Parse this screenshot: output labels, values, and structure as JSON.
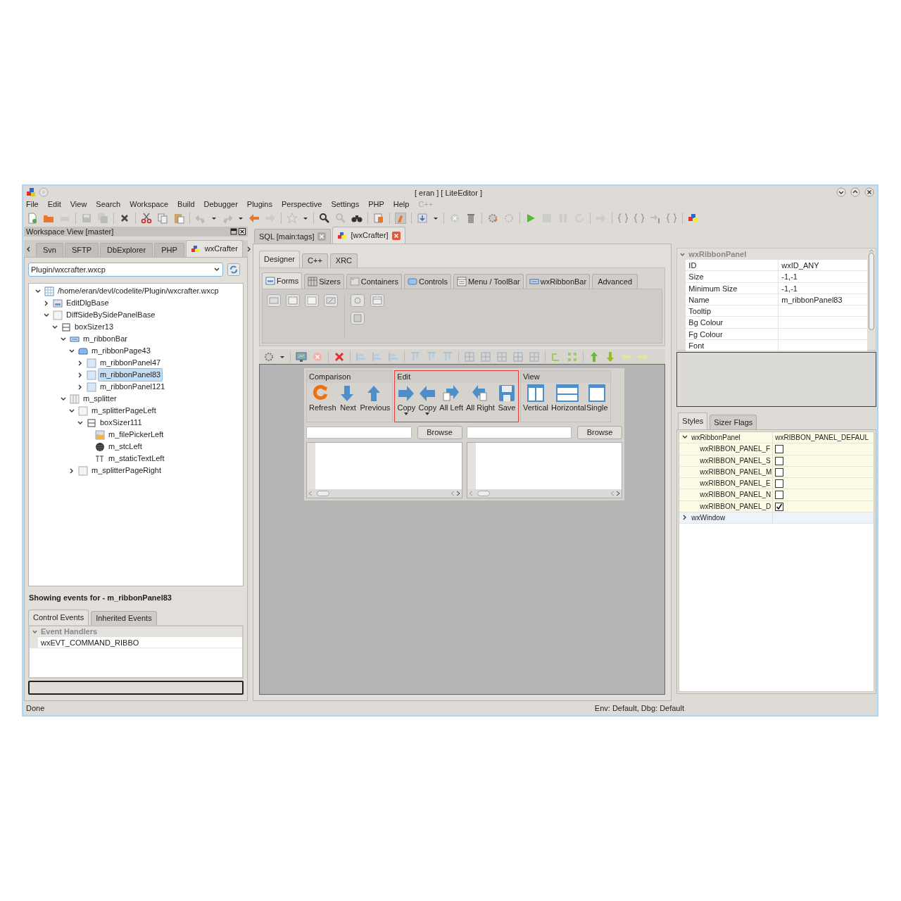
{
  "window": {
    "title": "[ eran ] [ LiteEditor ]"
  },
  "menu": [
    {
      "label": "File",
      "disabled": false
    },
    {
      "label": "Edit",
      "disabled": false
    },
    {
      "label": "View",
      "disabled": false
    },
    {
      "label": "Search",
      "disabled": false
    },
    {
      "label": "Workspace",
      "disabled": false
    },
    {
      "label": "Build",
      "disabled": false
    },
    {
      "label": "Debugger",
      "disabled": false
    },
    {
      "label": "Plugins",
      "disabled": false
    },
    {
      "label": "Perspective",
      "disabled": false
    },
    {
      "label": "Settings",
      "disabled": false
    },
    {
      "label": "PHP",
      "disabled": false
    },
    {
      "label": "Help",
      "disabled": false
    },
    {
      "label": "C++",
      "disabled": true
    }
  ],
  "workspace_view": {
    "title": "Workspace View [master]",
    "tabs": [
      {
        "label": "Svn",
        "selected": false
      },
      {
        "label": "SFTP",
        "selected": false
      },
      {
        "label": "DbExplorer",
        "selected": false
      },
      {
        "label": "PHP",
        "selected": false
      },
      {
        "label": "wxCrafter",
        "selected": true
      }
    ],
    "project": "Plugin/wxcrafter.wxcp",
    "tree": [
      {
        "label": "/home/eran/devl/codelite/Plugin/wxcrafter.wxcp",
        "kind": "project",
        "expanded": true,
        "selected": false,
        "children": [
          {
            "label": "EditDlgBase",
            "kind": "dialog",
            "expanded": false,
            "selected": false
          },
          {
            "label": "DiffSideBySidePanelBase",
            "kind": "panel",
            "expanded": true,
            "selected": false,
            "children": [
              {
                "label": "boxSizer13",
                "kind": "sizer",
                "expanded": true,
                "selected": false,
                "children": [
                  {
                    "label": "m_ribbonBar",
                    "kind": "ribbonbar",
                    "expanded": true,
                    "selected": false,
                    "children": [
                      {
                        "label": "m_ribbonPage43",
                        "kind": "ribbonpage",
                        "expanded": true,
                        "selected": false,
                        "children": [
                          {
                            "label": "m_ribbonPanel47",
                            "kind": "ribbonpanel",
                            "expanded": false,
                            "selected": false
                          },
                          {
                            "label": "m_ribbonPanel83",
                            "kind": "ribbonpanel",
                            "expanded": false,
                            "selected": true
                          },
                          {
                            "label": "m_ribbonPanel121",
                            "kind": "ribbonpanel",
                            "expanded": false,
                            "selected": false
                          }
                        ]
                      }
                    ]
                  },
                  {
                    "label": "m_splitter",
                    "kind": "splitter",
                    "expanded": true,
                    "selected": false,
                    "children": [
                      {
                        "label": "m_splitterPageLeft",
                        "kind": "panel",
                        "expanded": true,
                        "selected": false,
                        "children": [
                          {
                            "label": "boxSizer111",
                            "kind": "sizer",
                            "expanded": true,
                            "selected": false,
                            "children": [
                              {
                                "label": "m_filePickerLeft",
                                "kind": "filepicker",
                                "selected": false
                              },
                              {
                                "label": "m_stcLeft",
                                "kind": "stc",
                                "selected": false
                              },
                              {
                                "label": "m_staticTextLeft",
                                "kind": "statictext",
                                "selected": false
                              }
                            ]
                          }
                        ]
                      },
                      {
                        "label": "m_splitterPageRight",
                        "kind": "panel",
                        "expanded": false,
                        "selected": false
                      }
                    ]
                  }
                ]
              }
            ]
          }
        ]
      }
    ]
  },
  "events": {
    "heading": "Showing events for - m_ribbonPanel83",
    "tabs": [
      {
        "label": "Control Events",
        "selected": true
      },
      {
        "label": "Inherited Events",
        "selected": false
      }
    ],
    "group": "Event Handlers",
    "expanded": true,
    "handlers": [
      "wxEVT_COMMAND_RIBBO"
    ]
  },
  "editor_tabs": [
    {
      "label": "SQL [main:tags]",
      "selected": false
    },
    {
      "label": "[wxCrafter]",
      "selected": true
    }
  ],
  "designer": {
    "tabs": [
      {
        "label": "Designer",
        "selected": true
      },
      {
        "label": "C++",
        "selected": false
      },
      {
        "label": "XRC",
        "selected": false
      }
    ],
    "palette_tabs": [
      {
        "label": "Forms",
        "selected": true
      },
      {
        "label": "Sizers",
        "selected": false
      },
      {
        "label": "Containers",
        "selected": false
      },
      {
        "label": "Controls",
        "selected": false
      },
      {
        "label": "Menu / ToolBar",
        "selected": false
      },
      {
        "label": "wxRibbonBar",
        "selected": false
      },
      {
        "label": "Advanced",
        "selected": false
      }
    ],
    "ribbon": [
      {
        "title": "Comparison",
        "selected": false,
        "buttons": [
          {
            "label": "Refresh"
          },
          {
            "label": "Next"
          },
          {
            "label": "Previous"
          }
        ]
      },
      {
        "title": "Edit",
        "selected": true,
        "buttons": [
          {
            "label": "Copy",
            "dropdown": true
          },
          {
            "label": "Copy",
            "dropdown": true
          },
          {
            "label": "All Left"
          },
          {
            "label": "All Right"
          },
          {
            "label": "Save"
          }
        ]
      },
      {
        "title": "View",
        "selected": false,
        "buttons": [
          {
            "label": "Vertical"
          },
          {
            "label": "Horizontal"
          },
          {
            "label": "Single"
          }
        ]
      }
    ],
    "file_pickers": [
      {
        "button": "Browse"
      },
      {
        "button": "Browse"
      }
    ]
  },
  "properties": {
    "group": "wxRibbonPanel",
    "expanded": true,
    "rows": [
      {
        "name": "ID",
        "value": "wxID_ANY"
      },
      {
        "name": "Size",
        "value": "-1,-1"
      },
      {
        "name": "Minimum Size",
        "value": "-1,-1"
      },
      {
        "name": "Name",
        "value": "m_ribbonPanel83"
      },
      {
        "name": "Tooltip"
      },
      {
        "name": "Bg Colour"
      },
      {
        "name": "Fg Colour"
      },
      {
        "name": "Font"
      }
    ]
  },
  "styles": {
    "tabs": [
      {
        "label": "Styles",
        "selected": true
      },
      {
        "label": "Sizer Flags",
        "selected": false
      }
    ],
    "groups": [
      {
        "label": "wxRibbonPanel",
        "value": "wxRIBBON_PANEL_DEFAUL",
        "expanded": true,
        "children": [
          {
            "label": "wxRIBBON_PANEL_F",
            "checked": false
          },
          {
            "label": "wxRIBBON_PANEL_S",
            "checked": false
          },
          {
            "label": "wxRIBBON_PANEL_M",
            "checked": false
          },
          {
            "label": "wxRIBBON_PANEL_E",
            "checked": false
          },
          {
            "label": "wxRIBBON_PANEL_N",
            "checked": false
          },
          {
            "label": "wxRIBBON_PANEL_D",
            "checked": true
          }
        ]
      },
      {
        "label": "wxWindow",
        "expanded": false
      }
    ]
  },
  "status_bar": {
    "left": "Done",
    "right": "Env: Default, Dbg: Default"
  }
}
